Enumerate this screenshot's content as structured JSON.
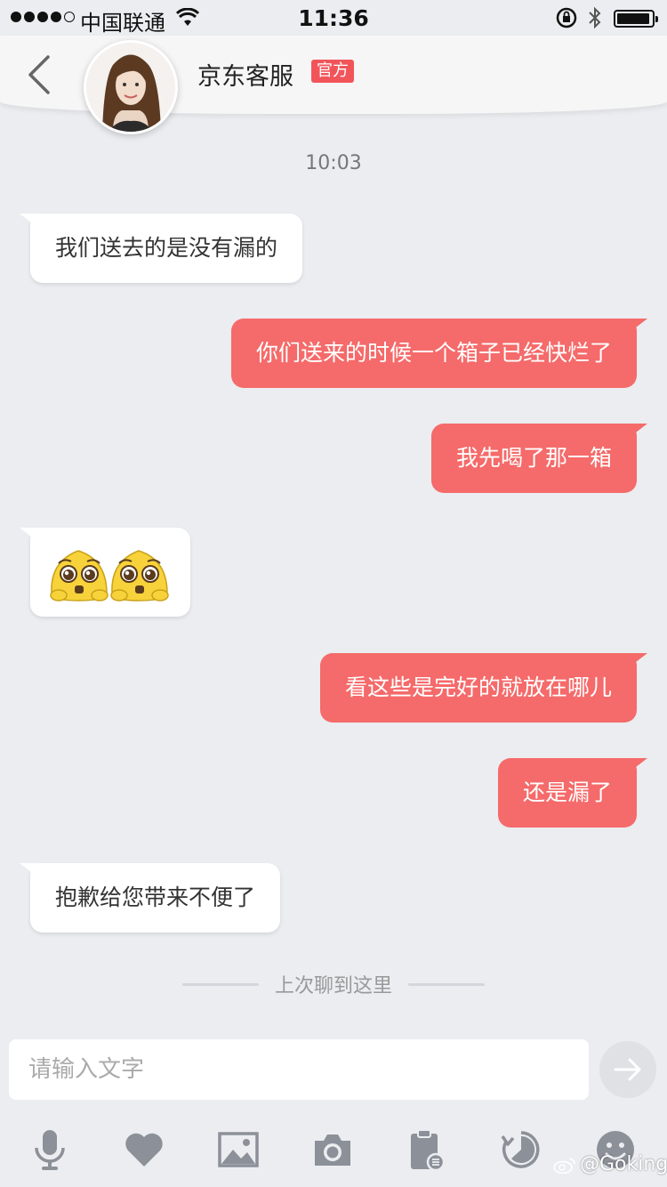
{
  "status_bar": {
    "carrier": "中国联通",
    "time": "11:36"
  },
  "header": {
    "contact_name": "京东客服",
    "badge": "官方"
  },
  "chat": {
    "timestamp": "10:03",
    "messages": [
      {
        "side": "in",
        "text": "我们送去的是没有漏的"
      },
      {
        "side": "out",
        "text": "你们送来的时候一个箱子已经快烂了"
      },
      {
        "side": "out",
        "text": "我先喝了那一箱"
      },
      {
        "side": "in",
        "emoji": "pleading-face-sticker x2"
      },
      {
        "side": "out",
        "text": "看这些是完好的就放在哪儿"
      },
      {
        "side": "out",
        "text": "还是漏了"
      },
      {
        "side": "in",
        "text": "抱歉给您带来不便了"
      }
    ],
    "last_read_divider": "上次聊到这里"
  },
  "composer": {
    "placeholder": "请输入文字"
  },
  "toolbar": [
    "microphone-icon",
    "heart-icon",
    "image-icon",
    "camera-icon",
    "clipboard-icon",
    "history-icon",
    "smiley-icon"
  ],
  "watermark": "@Goking",
  "colors": {
    "outgoing_bubble": "#f56a6a",
    "badge": "#f1555a",
    "background": "#ebedf0"
  }
}
